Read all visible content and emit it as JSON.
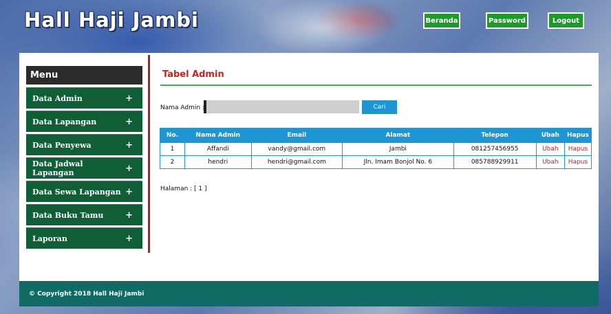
{
  "site_title": "Hall Haji Jambi",
  "topnav": {
    "beranda": "Beranda",
    "password": "Password",
    "logout": "Logout"
  },
  "menu": {
    "title": "Menu",
    "items": [
      "Data Admin",
      "Data Lapangan",
      "Data Penyewa",
      "Data Jadwal Lapangan",
      "Data Sewa Lapangan",
      "Data Buku Tamu",
      "Laporan"
    ],
    "expand_symbol": "+"
  },
  "content": {
    "title": "Tabel Admin",
    "search_label": "Nama Admin :",
    "search_value": "",
    "search_button": "Cari",
    "columns": [
      "No.",
      "Nama Admin",
      "Email",
      "Alamat",
      "Telepon",
      "Ubah",
      "Hapus"
    ],
    "rows": [
      {
        "no": "1",
        "nama": "Affandi",
        "email": "vandy@gmail.com",
        "alamat": "Jambi",
        "telepon": "081257456955",
        "ubah": "Ubah",
        "hapus": "Hapus"
      },
      {
        "no": "2",
        "nama": "hendri",
        "email": "hendri@gmail.com",
        "alamat": "Jln. Imam Bonjol No. 6",
        "telepon": "085788929911",
        "ubah": "Ubah",
        "hapus": "Hapus"
      }
    ],
    "pagination": "Halaman : [ 1 ]"
  },
  "footer": "© Copyright 2018 Hall Haji Jambi",
  "colors": {
    "menu_green": "#0f5e36",
    "nav_green": "#1c9a2a",
    "table_blue": "#1e96d4",
    "title_red": "#d21f1f",
    "footer_teal": "#0f6b64"
  }
}
